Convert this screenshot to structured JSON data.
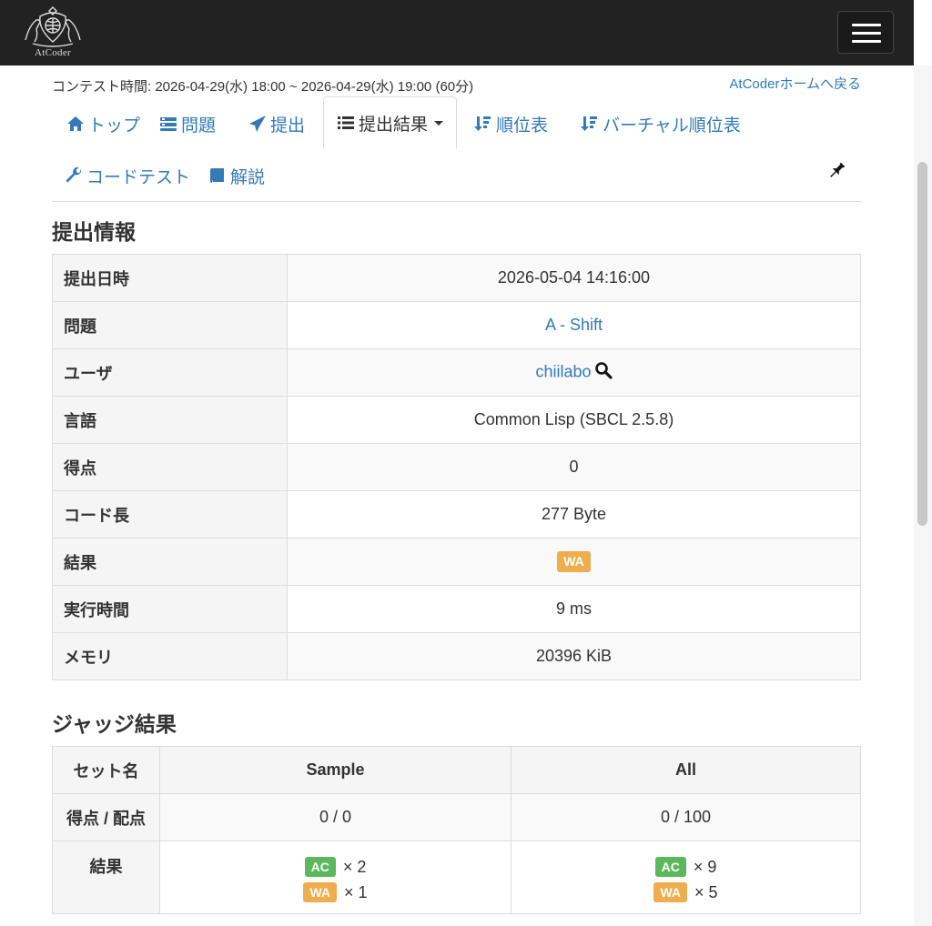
{
  "header": {
    "logo_text": "AtCoder",
    "menu_icon": "hamburger-icon"
  },
  "contest": {
    "time": "コンテスト時間: 2026-04-29(水) 18:00 ~ 2026-04-29(水) 19:00 (60分)",
    "home_link": "AtCoderホームへ戻る"
  },
  "tabs": [
    {
      "label": "トップ",
      "icon": "home-icon"
    },
    {
      "label": "問題",
      "icon": "tasks-icon"
    },
    {
      "label": "提出",
      "icon": "send-icon"
    },
    {
      "label": "提出結果",
      "icon": "list-icon"
    },
    {
      "label": "順位表",
      "icon": "sort-icon"
    },
    {
      "label": "バーチャル順位表",
      "icon": "sort-icon"
    },
    {
      "label": "コードテスト",
      "icon": "wrench-icon"
    },
    {
      "label": "解説",
      "icon": "book-icon"
    }
  ],
  "submission": {
    "heading": "提出情報",
    "rows": [
      {
        "label": "提出日時",
        "value": "2026-05-04 14:16:00"
      },
      {
        "label": "問題",
        "value": "A - Shift"
      },
      {
        "label": "ユーザ",
        "value": "chiilabo"
      },
      {
        "label": "言語",
        "value": "Common Lisp (SBCL 2.5.8)"
      },
      {
        "label": "得点",
        "value": "0"
      },
      {
        "label": "コード長",
        "value": "277 Byte"
      },
      {
        "label": "結果",
        "value": "WA"
      },
      {
        "label": "実行時間",
        "value": "9 ms"
      },
      {
        "label": "メモリ",
        "value": "20396 KiB"
      }
    ]
  },
  "judge": {
    "heading": "ジャッジ結果",
    "col_set": "セット名",
    "col_sample": "Sample",
    "col_all": "All",
    "row_score": "得点 / 配点",
    "row_result": "結果",
    "sample_score": "0 / 0",
    "all_score": "0 / 100",
    "sample_results": [
      {
        "status": "AC",
        "count": "× 2"
      },
      {
        "status": "WA",
        "count": "× 1"
      }
    ],
    "all_results": [
      {
        "status": "AC",
        "count": "× 9"
      },
      {
        "status": "WA",
        "count": "× 5"
      }
    ]
  },
  "colors": {
    "link": "#337ab7",
    "ac": "#5cb85c",
    "wa": "#f0ad4e",
    "navbar": "#222222"
  }
}
